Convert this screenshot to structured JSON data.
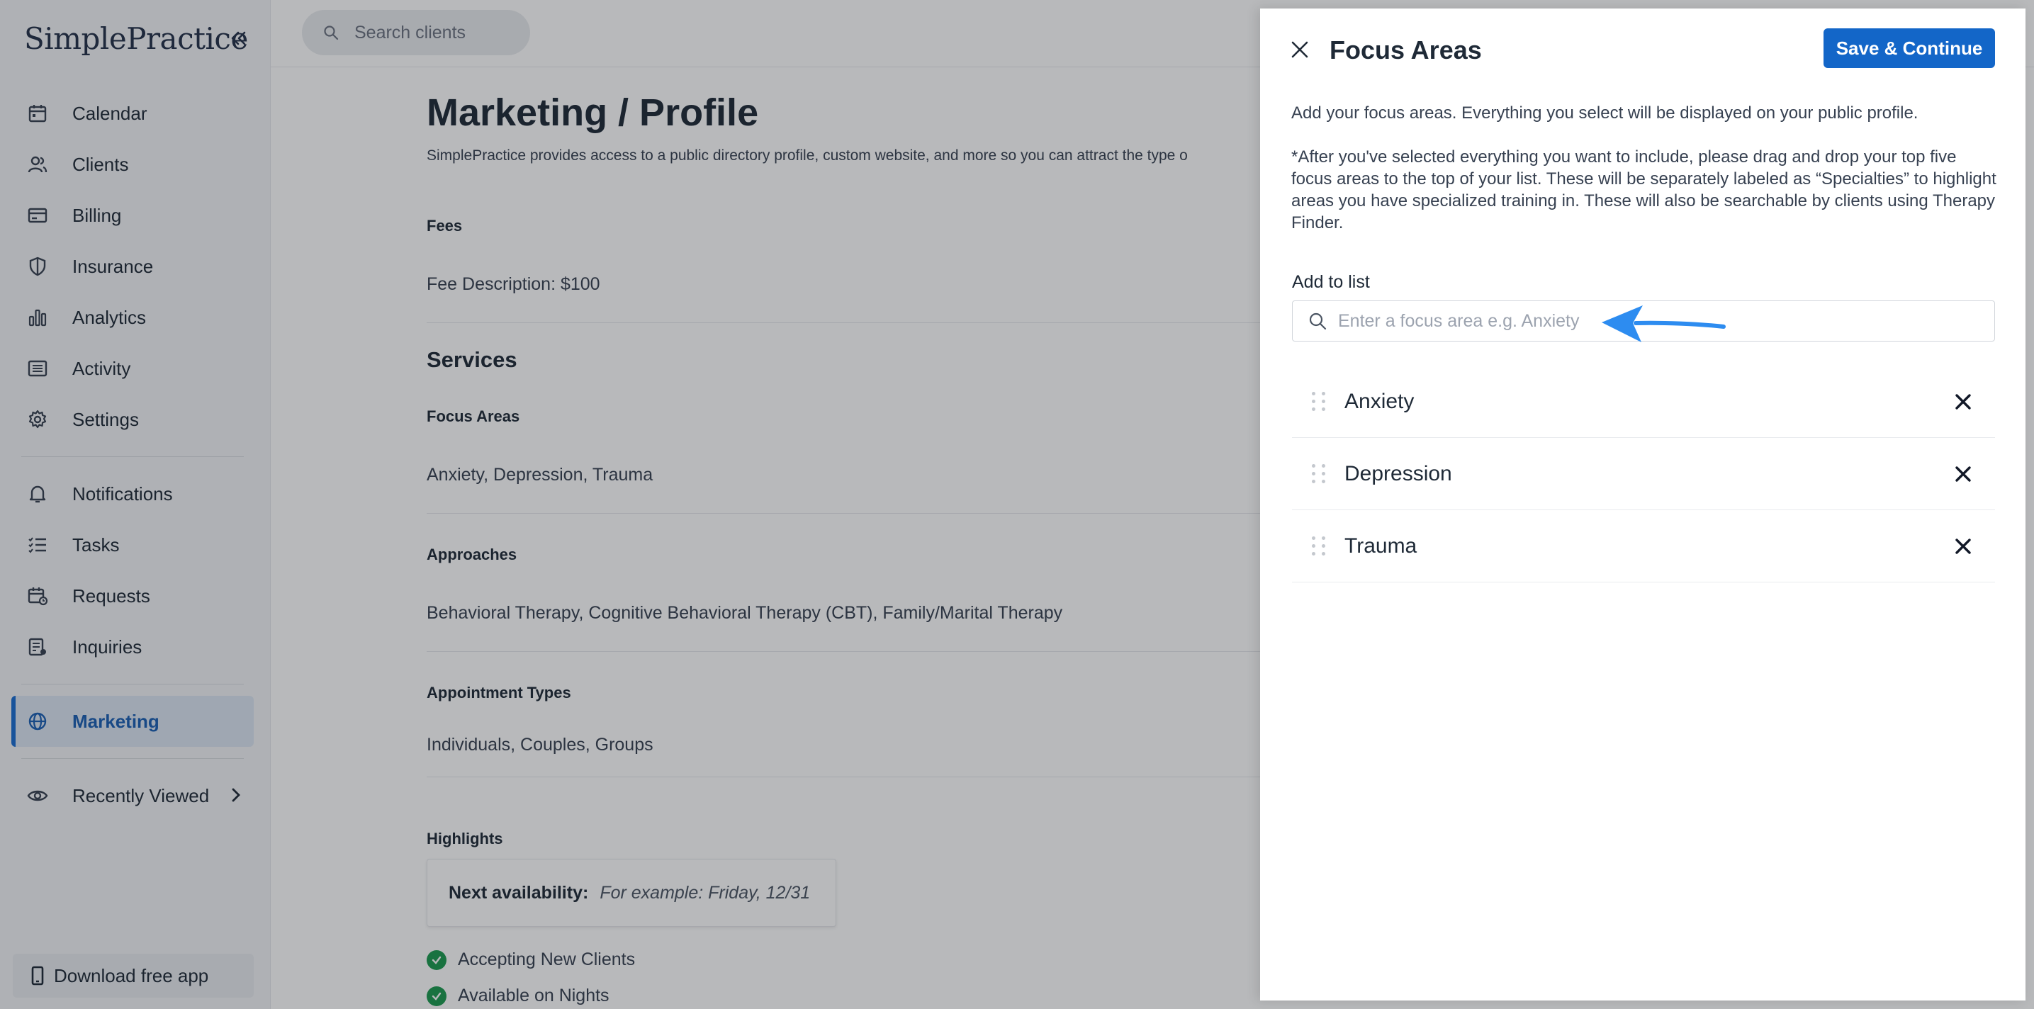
{
  "sidebar": {
    "logo": "SimplePractice",
    "items": [
      {
        "label": "Calendar",
        "icon": "calendar-icon"
      },
      {
        "label": "Clients",
        "icon": "clients-icon"
      },
      {
        "label": "Billing",
        "icon": "billing-icon"
      },
      {
        "label": "Insurance",
        "icon": "shield-icon"
      },
      {
        "label": "Analytics",
        "icon": "bar-chart-icon"
      },
      {
        "label": "Activity",
        "icon": "activity-list-icon"
      },
      {
        "label": "Settings",
        "icon": "gear-icon"
      },
      {
        "label": "Notifications",
        "icon": "bell-icon"
      },
      {
        "label": "Tasks",
        "icon": "tasks-icon"
      },
      {
        "label": "Requests",
        "icon": "requests-calendar-icon"
      },
      {
        "label": "Inquiries",
        "icon": "inquiries-icon"
      },
      {
        "label": "Marketing",
        "icon": "globe-icon",
        "active": true
      },
      {
        "label": "Recently Viewed",
        "icon": "eye-icon"
      }
    ],
    "download_label": "Download free app"
  },
  "search": {
    "placeholder": "Search clients"
  },
  "main": {
    "title": "Marketing / Profile",
    "subtitle": "SimplePractice provides access to a public directory profile, custom website, and more so you can attract the type o",
    "fees_label": "Fees",
    "fees_value": "Fee Description: $100",
    "services_heading": "Services",
    "focus_label": "Focus Areas",
    "focus_value": "Anxiety, Depression, Trauma",
    "approaches_label": "Approaches",
    "approaches_value": "Behavioral Therapy, Cognitive Behavioral Therapy (CBT), Family/Marital Therapy",
    "appt_label": "Appointment Types",
    "appt_value": "Individuals, Couples, Groups",
    "highlights_label": "Highlights",
    "next_avail_label": "Next availability:",
    "next_avail_placeholder": "For example: Friday, 12/31",
    "checks": [
      "Accepting New Clients",
      "Available on Nights"
    ]
  },
  "drawer": {
    "title": "Focus Areas",
    "save_label": "Save & Continue",
    "desc1": "Add your focus areas. Everything you select will be displayed on your public profile.",
    "desc2": "*After you've selected everything you want to include, please drag and drop your top five focus areas to the top of your list. These will be separately labeled as “Specialties” to highlight areas you have specialized training in. These will also be searchable by clients using Therapy Finder.",
    "add_label": "Add to list",
    "input_placeholder": "Enter a focus area e.g. Anxiety",
    "items": [
      {
        "label": "Anxiety"
      },
      {
        "label": "Depression"
      },
      {
        "label": "Trauma"
      }
    ]
  },
  "colors": {
    "accent": "#1366c8",
    "arrow": "#2d8cf0",
    "check": "#1c9a4f"
  }
}
